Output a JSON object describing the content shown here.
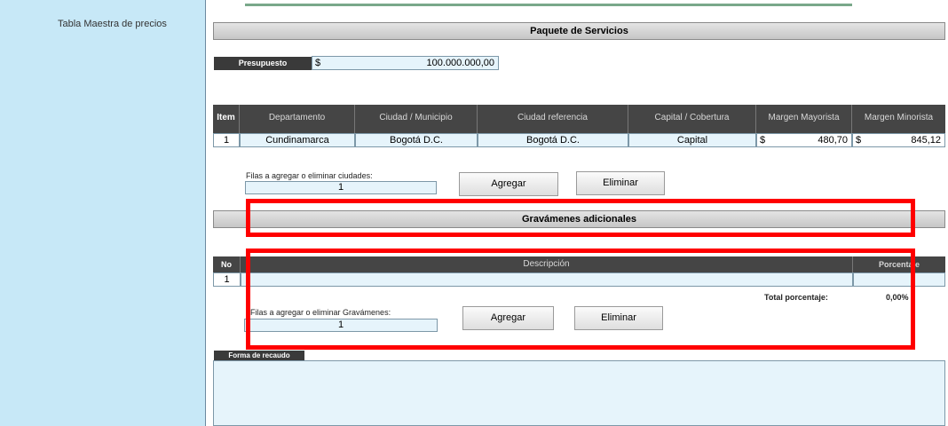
{
  "sidebar": {
    "link": "Tabla Maestra de precios"
  },
  "paquete": {
    "title": "Paquete de Servicios",
    "presupuesto_label": "Presupuesto",
    "currency": "$",
    "presupuesto_value": "100.000.000,00"
  },
  "table1": {
    "headers": [
      "Item",
      "Departamento",
      "Ciudad / Municipio",
      "Ciudad referencia",
      "Capital / Cobertura",
      "Margen Mayorista",
      "Margen Minorista"
    ],
    "row": {
      "item": "1",
      "departamento": "Cundinamarca",
      "ciudad": "Bogotá D.C.",
      "referencia": "Bogotá D.C.",
      "capital": "Capital",
      "may_currency": "$",
      "mayorista": "480,70",
      "min_currency": "$",
      "minorista": "845,12"
    }
  },
  "ciudades": {
    "label": "Filas a agregar o eliminar ciudades:",
    "value": "1",
    "agregar": "Agregar",
    "eliminar": "Eliminar"
  },
  "gravamenes": {
    "title": "Gravámenes adicionales",
    "headers": [
      "No",
      "Descripción",
      "Porcentaje"
    ],
    "row_no": "1",
    "total_label": "Total porcentaje:",
    "total_value": "0,00%",
    "label": "Filas a agregar o eliminar Gravámenes:",
    "value": "1",
    "agregar": "Agregar",
    "eliminar": "Eliminar"
  },
  "recaudo": {
    "label": "Forma de recaudo"
  },
  "colors": {
    "highlight": "#ff0000",
    "sidebar": "#c7e8f7",
    "field": "#e6f4fb"
  }
}
